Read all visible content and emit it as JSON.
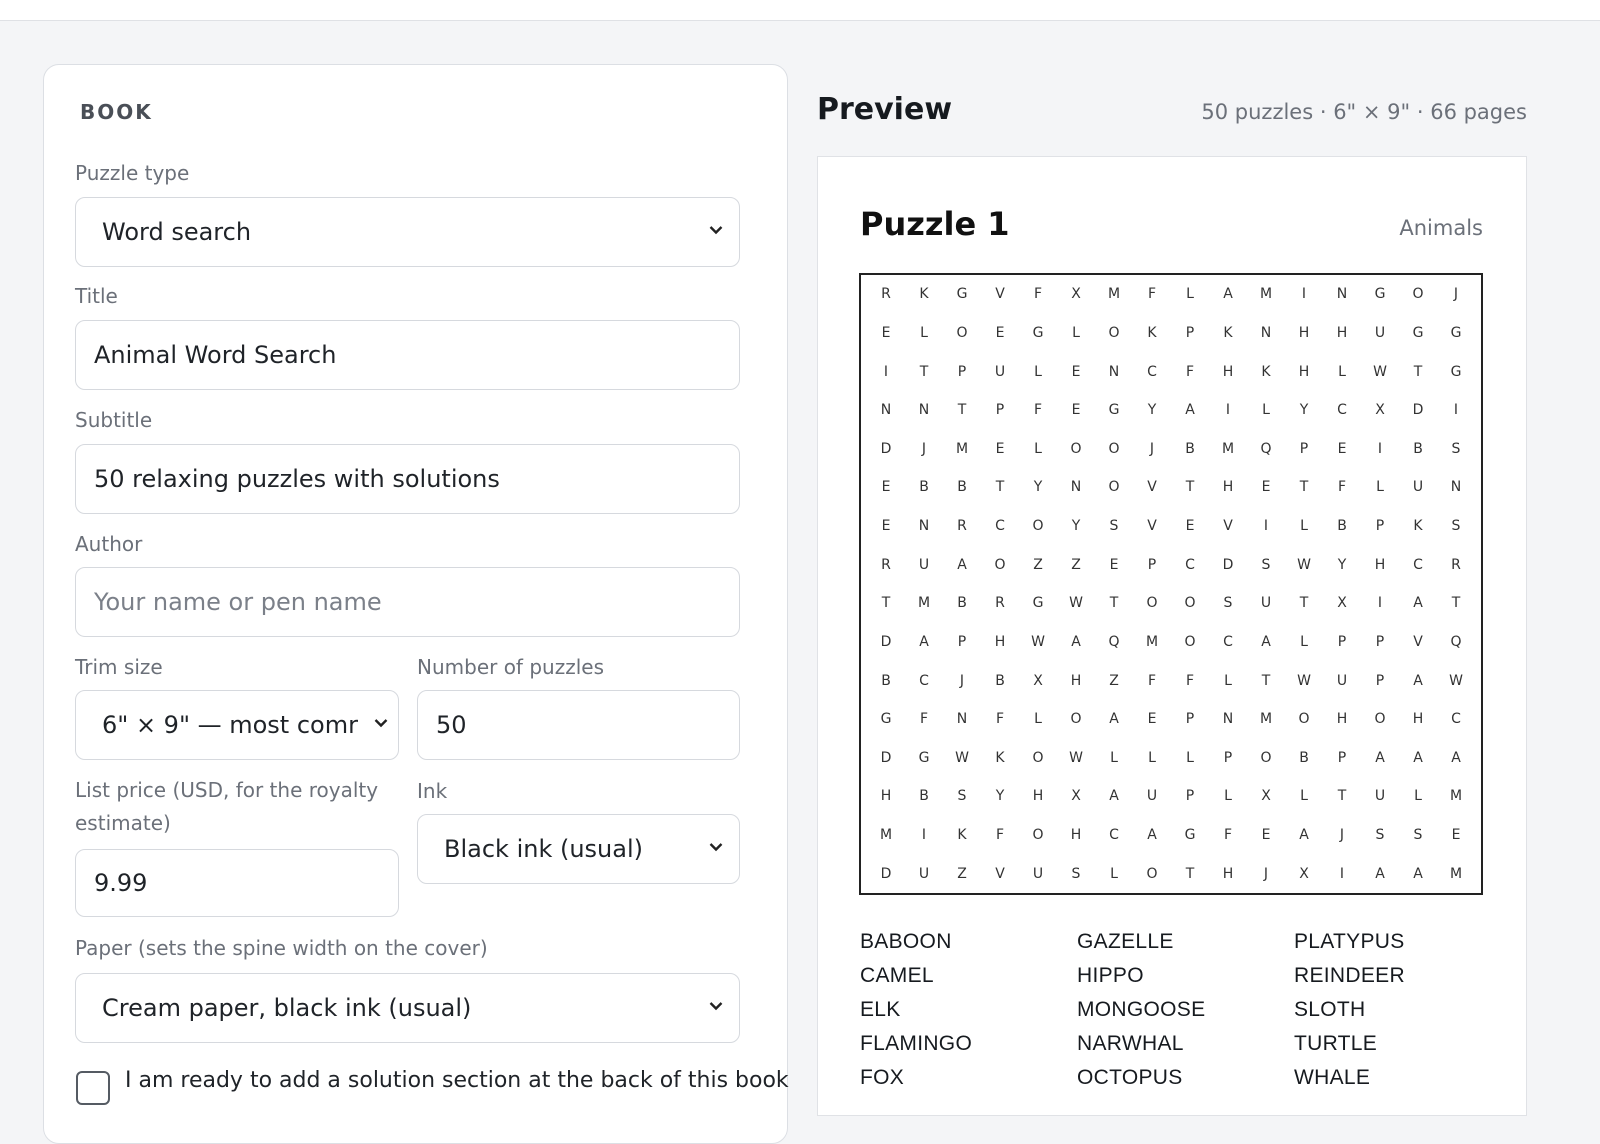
{
  "form": {
    "section_title": "BOOK",
    "puzzle_type": {
      "label": "Puzzle type",
      "value": "Word search"
    },
    "title": {
      "label": "Title",
      "value": "Animal Word Search"
    },
    "subtitle": {
      "label": "Subtitle",
      "value": "50 relaxing puzzles with solutions"
    },
    "author": {
      "label": "Author",
      "value": "",
      "placeholder": "Your name or pen name"
    },
    "trim_size": {
      "label": "Trim size",
      "value": "6\" × 9\" — most comr"
    },
    "num_puzzles": {
      "label": "Number of puzzles",
      "value": "50"
    },
    "list_price": {
      "label": "List price (USD, for the royalty estimate)",
      "value": "9.99"
    },
    "ink": {
      "label": "Ink",
      "value": "Black ink (usual)"
    },
    "paper": {
      "label": "Paper (sets the spine width on the cover)",
      "value": "Cream paper, black ink (usual)"
    },
    "checkbox_label": "I am ready to add a solution section at the back of this book"
  },
  "preview": {
    "title": "Preview",
    "meta": "50 puzzles · 6\" × 9\" · 66 pages",
    "puzzle_title": "Puzzle 1",
    "theme": "Animals",
    "grid": [
      "RKGVFXMFLAMINGOJ",
      "ELOEGLOKPKNHHUGG",
      "ITPULENCFHKHLWTG",
      "NNTPFEGYAILYCXDI",
      "DJMELOOJBMQPEIBS",
      "EBBTYNOVTHETFLUN",
      "ENRCOYSVEVILBPKS",
      "RUAOZZEPCDSWYHCR",
      "TMBRGWTOOSUTXIAT",
      "DAPHWAQMOCALPPVQ",
      "BCJBXHZFFLTWUPAW",
      "GFNFLOAEPNMOHOHC",
      "DGWKOWLLLPOBPAAA",
      "HBSYHXAUPLXLTULM",
      "MIKFOHCAGFEAJSSE",
      "DUZVUSLOTHJXIAAM"
    ],
    "words": [
      "BABOON",
      "GAZELLE",
      "PLATYPUS",
      "CAMEL",
      "HIPPO",
      "REINDEER",
      "ELK",
      "MONGOOSE",
      "SLOTH",
      "FLAMINGO",
      "NARWHAL",
      "TURTLE",
      "FOX",
      "OCTOPUS",
      "WHALE"
    ]
  },
  "icons": {
    "select_chevron": "chevron-down-icon"
  }
}
